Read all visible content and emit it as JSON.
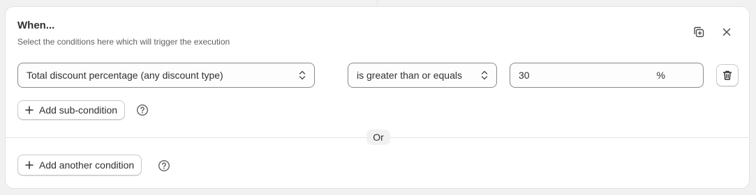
{
  "condition_block": {
    "title": "When...",
    "subtitle": "Select the conditions here which will trigger the execution",
    "field_select": {
      "value": "Total discount percentage (any discount type)"
    },
    "operator_select": {
      "value": "is greater than or equals"
    },
    "value_input": {
      "value": "30",
      "suffix": "%"
    },
    "add_sub_condition_label": "Add sub-condition",
    "or_label": "Or",
    "add_another_condition_label": "Add another condition"
  },
  "icons": {
    "duplicate": "duplicate-icon",
    "close": "close-icon",
    "delete": "trash-icon",
    "select_chevron": "select-chevron-icon",
    "plus": "plus-icon",
    "help": "question-circle-icon"
  },
  "colors": {
    "page_background": "#f1f1f1",
    "card_background": "#ffffff",
    "border": "#8a8a8a",
    "text": "#303030",
    "muted_text": "#616161"
  }
}
